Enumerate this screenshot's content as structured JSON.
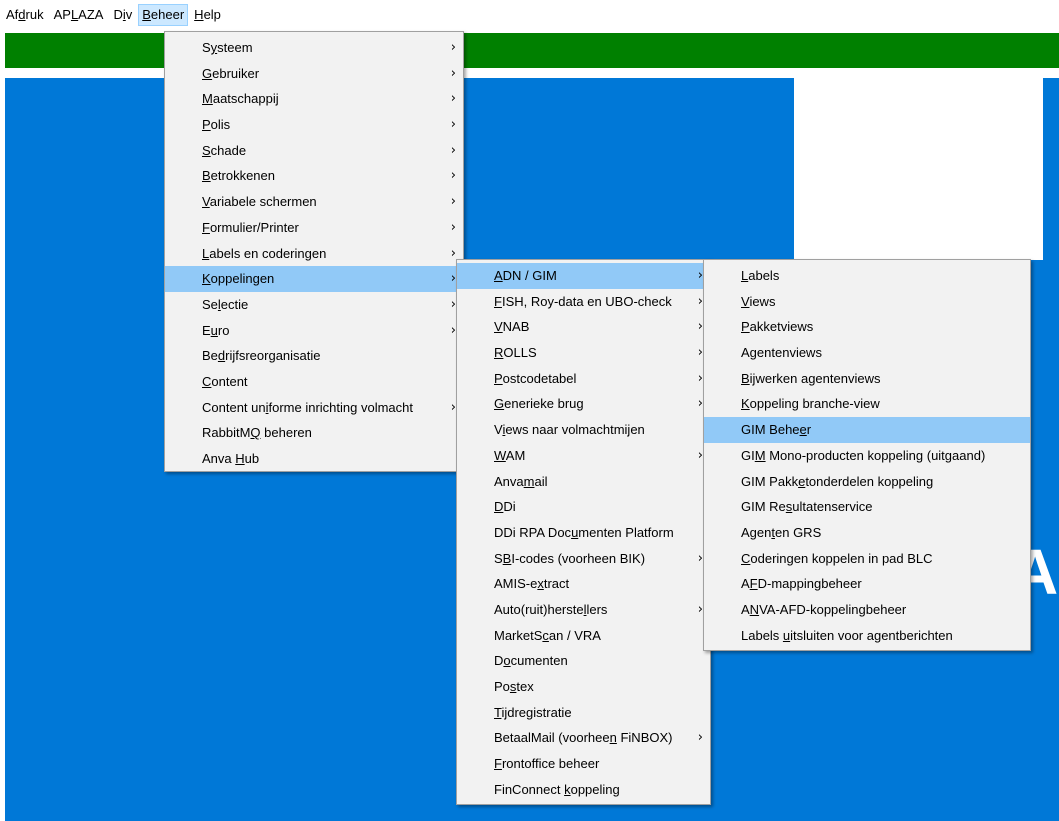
{
  "menubar": [
    {
      "name": "afdruk",
      "pre": "Af",
      "acc": "d",
      "post": "ruk"
    },
    {
      "name": "aplaza",
      "pre": "AP",
      "acc": "L",
      "post": "AZA"
    },
    {
      "name": "div",
      "pre": "D",
      "acc": "i",
      "post": "v"
    },
    {
      "name": "beheer",
      "pre": "",
      "acc": "B",
      "post": "eheer",
      "active": true
    },
    {
      "name": "help",
      "pre": "",
      "acc": "H",
      "post": "elp"
    }
  ],
  "menus": [
    {
      "name": "beheer-menu",
      "items": [
        {
          "pre": "S",
          "acc": "y",
          "post": "steem",
          "sub": true
        },
        {
          "pre": "",
          "acc": "G",
          "post": "ebruiker",
          "sub": true
        },
        {
          "pre": "",
          "acc": "M",
          "post": "aatschappij",
          "sub": true
        },
        {
          "pre": "",
          "acc": "P",
          "post": "olis",
          "sub": true
        },
        {
          "pre": "",
          "acc": "S",
          "post": "chade",
          "sub": true
        },
        {
          "pre": "",
          "acc": "B",
          "post": "etrokkenen",
          "sub": true
        },
        {
          "pre": "",
          "acc": "V",
          "post": "ariabele schermen",
          "sub": true
        },
        {
          "pre": "",
          "acc": "F",
          "post": "ormulier/Printer",
          "sub": true
        },
        {
          "pre": "",
          "acc": "L",
          "post": "abels en coderingen",
          "sub": true
        },
        {
          "pre": "",
          "acc": "K",
          "post": "oppelingen",
          "sub": true,
          "hl": true
        },
        {
          "pre": "Se",
          "acc": "l",
          "post": "ectie",
          "sub": true
        },
        {
          "pre": "E",
          "acc": "u",
          "post": "ro",
          "sub": true
        },
        {
          "pre": "Be",
          "acc": "d",
          "post": "rijfsreorganisatie"
        },
        {
          "pre": "",
          "acc": "C",
          "post": "ontent"
        },
        {
          "pre": "Content un",
          "acc": "i",
          "post": "forme inrichting volmacht",
          "sub": true
        },
        {
          "pre": "RabbitM",
          "acc": "Q",
          "post": " beheren"
        },
        {
          "pre": "Anva ",
          "acc": "H",
          "post": "ub"
        }
      ]
    },
    {
      "name": "koppelingen-menu",
      "items": [
        {
          "pre": "",
          "acc": "A",
          "post": "DN / GIM",
          "sub": true,
          "hl": true
        },
        {
          "pre": "",
          "acc": "F",
          "post": "ISH, Roy-data en UBO-check",
          "sub": true
        },
        {
          "pre": "",
          "acc": "V",
          "post": "NAB",
          "sub": true
        },
        {
          "pre": "",
          "acc": "R",
          "post": "OLLS",
          "sub": true
        },
        {
          "pre": "",
          "acc": "P",
          "post": "ostcodetabel",
          "sub": true
        },
        {
          "pre": "",
          "acc": "G",
          "post": "enerieke brug",
          "sub": true
        },
        {
          "pre": "V",
          "acc": "i",
          "post": "ews naar volmachtmijen"
        },
        {
          "pre": "",
          "acc": "W",
          "post": "AM",
          "sub": true
        },
        {
          "pre": "Anva",
          "acc": "m",
          "post": "ail"
        },
        {
          "pre": "",
          "acc": "D",
          "post": "Di"
        },
        {
          "pre": "DDi RPA Doc",
          "acc": "u",
          "post": "menten Platform"
        },
        {
          "pre": "S",
          "acc": "B",
          "post": "I-codes (voorheen BIK)",
          "sub": true
        },
        {
          "pre": "AMIS-e",
          "acc": "x",
          "post": "tract"
        },
        {
          "pre": "Auto(ruit)herste",
          "acc": "l",
          "post": "lers",
          "sub": true
        },
        {
          "pre": "MarketS",
          "acc": "c",
          "post": "an / VRA"
        },
        {
          "pre": "D",
          "acc": "o",
          "post": "cumenten"
        },
        {
          "pre": "Po",
          "acc": "s",
          "post": "tex"
        },
        {
          "pre": "",
          "acc": "T",
          "post": "ijdregistratie"
        },
        {
          "pre": "BetaalMail (voorhee",
          "acc": "n",
          "post": " FiNBOX)",
          "sub": true
        },
        {
          "pre": "",
          "acc": "F",
          "post": "rontoffice beheer"
        },
        {
          "pre": "FinConnect ",
          "acc": "k",
          "post": "oppeling"
        }
      ]
    },
    {
      "name": "adn-gim-menu",
      "items": [
        {
          "pre": "",
          "acc": "L",
          "post": "abels"
        },
        {
          "pre": "",
          "acc": "V",
          "post": "iews"
        },
        {
          "pre": "",
          "acc": "P",
          "post": "akketviews"
        },
        {
          "pre": "A",
          "acc": "g",
          "post": "entenviews"
        },
        {
          "pre": "",
          "acc": "B",
          "post": "ijwerken agentenviews"
        },
        {
          "pre": "",
          "acc": "K",
          "post": "oppeling branche-view"
        },
        {
          "pre": "GIM Behe",
          "acc": "e",
          "post": "r",
          "hl": true
        },
        {
          "pre": "GI",
          "acc": "M",
          "post": " Mono-producten koppeling (uitgaand)"
        },
        {
          "pre": "GIM Pakk",
          "acc": "e",
          "post": "tonderdelen koppeling"
        },
        {
          "pre": "GIM Re",
          "acc": "s",
          "post": "ultatenservice"
        },
        {
          "pre": "Agen",
          "acc": "t",
          "post": "en GRS"
        },
        {
          "pre": "",
          "acc": "C",
          "post": "oderingen koppelen in pad BLC"
        },
        {
          "pre": "A",
          "acc": "F",
          "post": "D-mappingbeheer"
        },
        {
          "pre": "A",
          "acc": "N",
          "post": "VA-AFD-koppelingbeheer"
        },
        {
          "pre": "Labels ",
          "acc": "u",
          "post": "itsluiten voor agentberichten"
        }
      ]
    }
  ],
  "background_text": "A",
  "icons": {
    "submenu_arrow": "chevron-right-icon",
    "arrow_glyph": "›"
  },
  "colors": {
    "menubar_active": "#cce8ff",
    "menu_bg": "#f2f2f2",
    "menu_highlight": "#91c9f7",
    "green_bar": "#008000",
    "blue_area": "#0078d7"
  }
}
